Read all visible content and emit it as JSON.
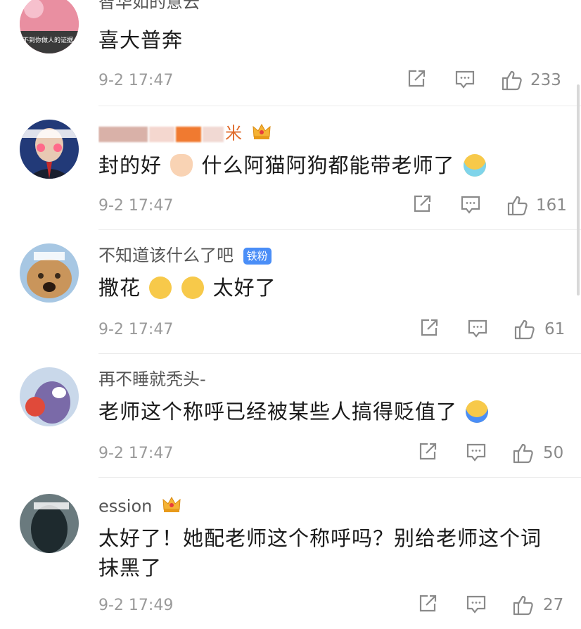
{
  "comments": [
    {
      "username": "智华如的意云",
      "content": "喜大普奔",
      "time": "9-2 17:47",
      "likes": "233",
      "avatar_text": "不到你做人的证据"
    },
    {
      "username": "米",
      "content_pre": "封的好",
      "content_post": "什么阿猫阿狗都能带老师了",
      "time": "9-2 17:47",
      "likes": "161"
    },
    {
      "username": "不知道该什么了吧",
      "badge": "铁粉",
      "content_pre": "撒花",
      "content_post": "太好了",
      "time": "9-2 17:47",
      "likes": "61"
    },
    {
      "username": "再不睡就秃头-",
      "content": "老师这个称呼已经被某些人搞得贬值了",
      "time": "9-2 17:47",
      "likes": "50"
    },
    {
      "username": "ession",
      "content_line1": "太好了！她配老师这个称呼吗？别给老师这个词",
      "content_line2": "抹黑了",
      "time": "9-2 17:49",
      "likes": "27"
    }
  ],
  "icons": {
    "share": "share-icon",
    "comment": "comment-icon",
    "like": "thumbs-up-icon",
    "crown": "crown-badge-icon"
  },
  "colors": {
    "time": "#9a9a9a",
    "fan_badge": "#4a8ef7",
    "icon": "#8a8a8a"
  }
}
